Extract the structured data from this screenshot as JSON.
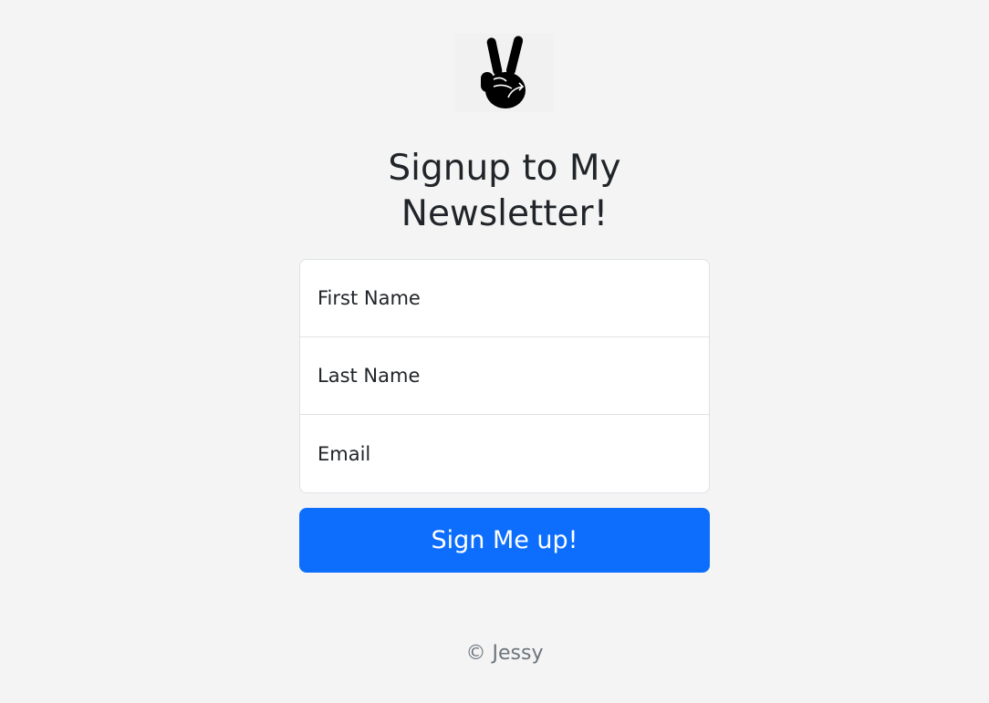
{
  "logo": {
    "icon": "victory-hand-icon"
  },
  "heading": {
    "title": "Signup to My Newsletter!"
  },
  "form": {
    "first_name_placeholder": "First Name",
    "last_name_placeholder": "Last Name",
    "email_placeholder": "Email",
    "submit_label": "Sign Me up!"
  },
  "footer": {
    "text": "© Jessy"
  },
  "colors": {
    "background": "#f4f4f4",
    "primary": "#0d6efd",
    "text": "#212529",
    "muted": "#6c757d"
  }
}
